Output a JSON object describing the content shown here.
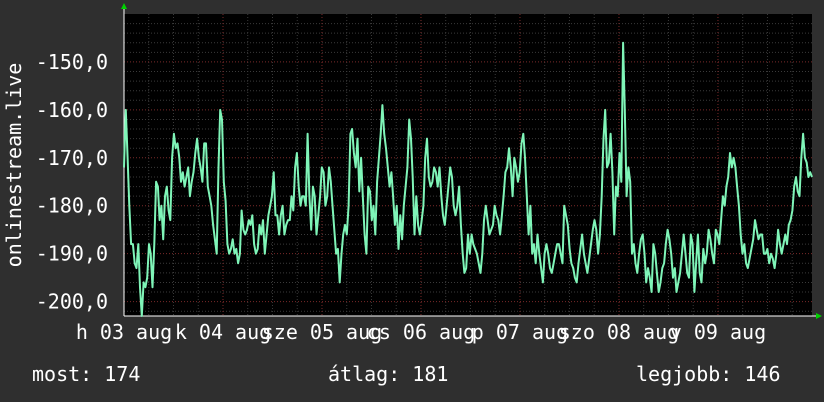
{
  "colors": {
    "background": "#2f2f2f",
    "plot_background": "#000000",
    "grid_minor": "#3a3a3a",
    "grid_major": "#7a2a2a",
    "line": "#7ff5b8",
    "axis_arrow": "#00d000",
    "text": "#ffffff"
  },
  "stats": {
    "current": "most: 174",
    "average": "átlag: 181",
    "best": "legjobb: 146"
  },
  "chart_data": {
    "type": "line",
    "ylabel": "onlinestream.live",
    "ylim": [
      -203,
      -140
    ],
    "y_ticks": [
      -150,
      -160,
      -170,
      -180,
      -190,
      -200
    ],
    "y_tick_labels": [
      "-150,0",
      "-160,0",
      "-170,0",
      "-180,0",
      "-190,0",
      "-200,0"
    ],
    "x_tick_labels": [
      "h 03 aug",
      "k 04 aug",
      "sze 05 aug",
      "cs 06 aug",
      "p 07 aug",
      "szo 08 aug",
      "v 09 aug"
    ],
    "x_tick_positions": [
      0,
      1,
      2,
      3,
      4,
      5,
      6
    ],
    "xlim": [
      0,
      6.95
    ],
    "grid": true,
    "series": [
      {
        "values": [
          -172,
          -160,
          -170,
          -180,
          -188,
          -188,
          -192,
          -193,
          -188,
          -197,
          -203,
          -196,
          -197,
          -195,
          -188,
          -190,
          -197,
          -188,
          -175,
          -176,
          -183,
          -180,
          -187,
          -178,
          -176,
          -181,
          -183,
          -170,
          -165,
          -168,
          -167,
          -170,
          -175,
          -173,
          -176,
          -174,
          -172,
          -178,
          -175,
          -173,
          -169,
          -166,
          -170,
          -172,
          -175,
          -167,
          -167,
          -176,
          -178,
          -180,
          -184,
          -187,
          -190,
          -172,
          -160,
          -162,
          -175,
          -179,
          -188,
          -190,
          -189,
          -187,
          -190,
          -189,
          -192,
          -190,
          -181,
          -185,
          -186,
          -185,
          -183,
          -184,
          -182,
          -188,
          -190,
          -189,
          -184,
          -186,
          -183,
          -190,
          -186,
          -182,
          -180,
          -178,
          -173,
          -182,
          -182,
          -186,
          -182,
          -180,
          -186,
          -184,
          -183,
          -183,
          -178,
          -181,
          -172,
          -169,
          -176,
          -180,
          -178,
          -178,
          -180,
          -165,
          -178,
          -185,
          -176,
          -178,
          -186,
          -182,
          -178,
          -172,
          -173,
          -180,
          -178,
          -172,
          -175,
          -180,
          -185,
          -190,
          -189,
          -196,
          -190,
          -186,
          -184,
          -186,
          -180,
          -165,
          -164,
          -169,
          -172,
          -166,
          -177,
          -170,
          -178,
          -186,
          -190,
          -176,
          -177,
          -183,
          -180,
          -186,
          -175,
          -170,
          -165,
          -159,
          -165,
          -168,
          -172,
          -176,
          -173,
          -178,
          -184,
          -180,
          -189,
          -182,
          -187,
          -180,
          -176,
          -172,
          -162,
          -166,
          -174,
          -186,
          -178,
          -184,
          -186,
          -183,
          -180,
          -170,
          -166,
          -174,
          -176,
          -175,
          -172,
          -173,
          -176,
          -172,
          -178,
          -182,
          -184,
          -180,
          -176,
          -172,
          -174,
          -180,
          -182,
          -180,
          -176,
          -184,
          -190,
          -194,
          -193,
          -186,
          -190,
          -186,
          -188,
          -189,
          -190,
          -192,
          -194,
          -190,
          -183,
          -180,
          -183,
          -186,
          -185,
          -184,
          -180,
          -182,
          -183,
          -186,
          -182,
          -178,
          -173,
          -172,
          -168,
          -172,
          -178,
          -170,
          -172,
          -175,
          -173,
          -167,
          -165,
          -170,
          -178,
          -186,
          -180,
          -190,
          -188,
          -192,
          -186,
          -190,
          -193,
          -196,
          -190,
          -188,
          -190,
          -193,
          -194,
          -192,
          -190,
          -188,
          -188,
          -190,
          -192,
          -180,
          -182,
          -184,
          -189,
          -192,
          -193,
          -195,
          -196,
          -192,
          -189,
          -186,
          -190,
          -192,
          -194,
          -191,
          -188,
          -185,
          -183,
          -185,
          -190,
          -186,
          -178,
          -166,
          -160,
          -172,
          -171,
          -165,
          -173,
          -186,
          -176,
          -178,
          -169,
          -175,
          -146,
          -160,
          -178,
          -172,
          -175,
          -190,
          -188,
          -192,
          -194,
          -190,
          -187,
          -186,
          -190,
          -196,
          -193,
          -195,
          -198,
          -188,
          -190,
          -194,
          -198,
          -196,
          -193,
          -192,
          -188,
          -185,
          -187,
          -190,
          -195,
          -193,
          -198,
          -196,
          -194,
          -190,
          -186,
          -190,
          -194,
          -195,
          -186,
          -188,
          -198,
          -192,
          -186,
          -194,
          -196,
          -189,
          -192,
          -190,
          -185,
          -187,
          -190,
          -192,
          -185,
          -186,
          -188,
          -183,
          -178,
          -180,
          -176,
          -174,
          -169,
          -172,
          -170,
          -172,
          -176,
          -180,
          -186,
          -190,
          -188,
          -192,
          -193,
          -191,
          -189,
          -187,
          -183,
          -185,
          -187,
          -186,
          -186,
          -190,
          -190,
          -189,
          -192,
          -190,
          -191,
          -193,
          -190,
          -185,
          -188,
          -190,
          -188,
          -186,
          -188,
          -184,
          -183,
          -181,
          -176,
          -174,
          -177,
          -178,
          -170,
          -165,
          -170,
          -171,
          -174,
          -173,
          -174
        ]
      }
    ]
  }
}
